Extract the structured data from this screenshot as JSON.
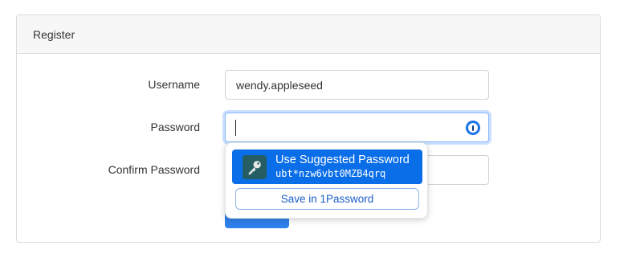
{
  "card": {
    "title": "Register"
  },
  "form": {
    "username": {
      "label": "Username",
      "value": "wendy.appleseed"
    },
    "password": {
      "label": "Password",
      "value": ""
    },
    "confirm_password": {
      "label": "Confirm Password",
      "value": ""
    }
  },
  "password_manager_popup": {
    "suggest_title": "Use Suggested Password",
    "suggested_password": "ubt*nzw6vbt0MZB4qrq",
    "save_label": "Save in 1Password",
    "icon": "key-icon"
  },
  "colors": {
    "primary": "#0a6ee8",
    "key_background": "#245e63",
    "focus_ring": "#86b7fe"
  }
}
